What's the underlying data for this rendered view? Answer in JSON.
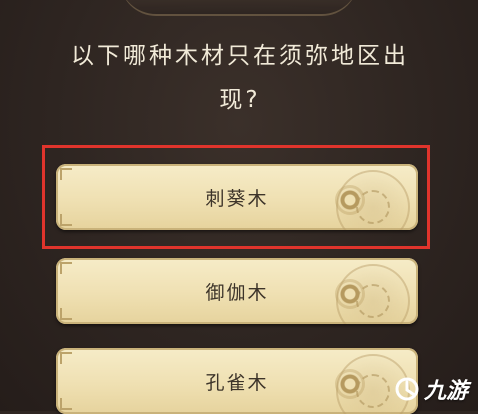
{
  "question": {
    "line1": "以下哪种木材只在须弥地区出",
    "line2": "现?"
  },
  "options": [
    {
      "label": "刺葵木",
      "highlighted": true
    },
    {
      "label": "御伽木",
      "highlighted": false
    },
    {
      "label": "孔雀木",
      "highlighted": false
    }
  ],
  "watermark": {
    "icon": "nine-game-logo-icon",
    "text": "九游"
  },
  "colors": {
    "background": "#2f2622",
    "question_text": "#f1ead8",
    "option_fill": "#efe0b2",
    "option_text": "#3d342a",
    "highlight_border": "#e0342c"
  }
}
